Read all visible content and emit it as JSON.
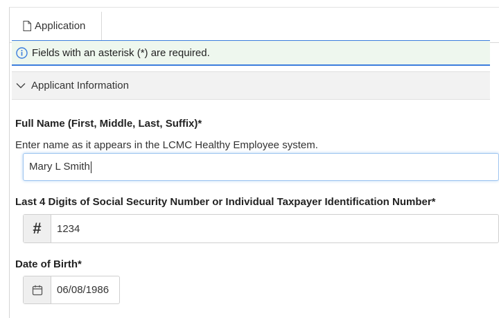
{
  "tabs": [
    {
      "label": "Application",
      "icon": "document-icon"
    }
  ],
  "notice": {
    "text": "Fields with an asterisk (*) are required.",
    "icon": "info-icon",
    "accent": "#3b7ddd",
    "background": "#eef7ee"
  },
  "section": {
    "title": "Applicant Information",
    "icon": "chevron-down-icon"
  },
  "fields": {
    "full_name": {
      "label": "Full Name (First, Middle, Last, Suffix)*",
      "help": "Enter name as it appears in the LCMC Healthy Employee system.",
      "value": "Mary L Smith"
    },
    "ssn_last4": {
      "label": "Last 4 Digits of Social Security Number or Individual Taxpayer Identification Number*",
      "addon": "#",
      "value": "1234"
    },
    "dob": {
      "label": "Date of Birth*",
      "icon": "calendar-icon",
      "value": "06/08/1986"
    }
  }
}
